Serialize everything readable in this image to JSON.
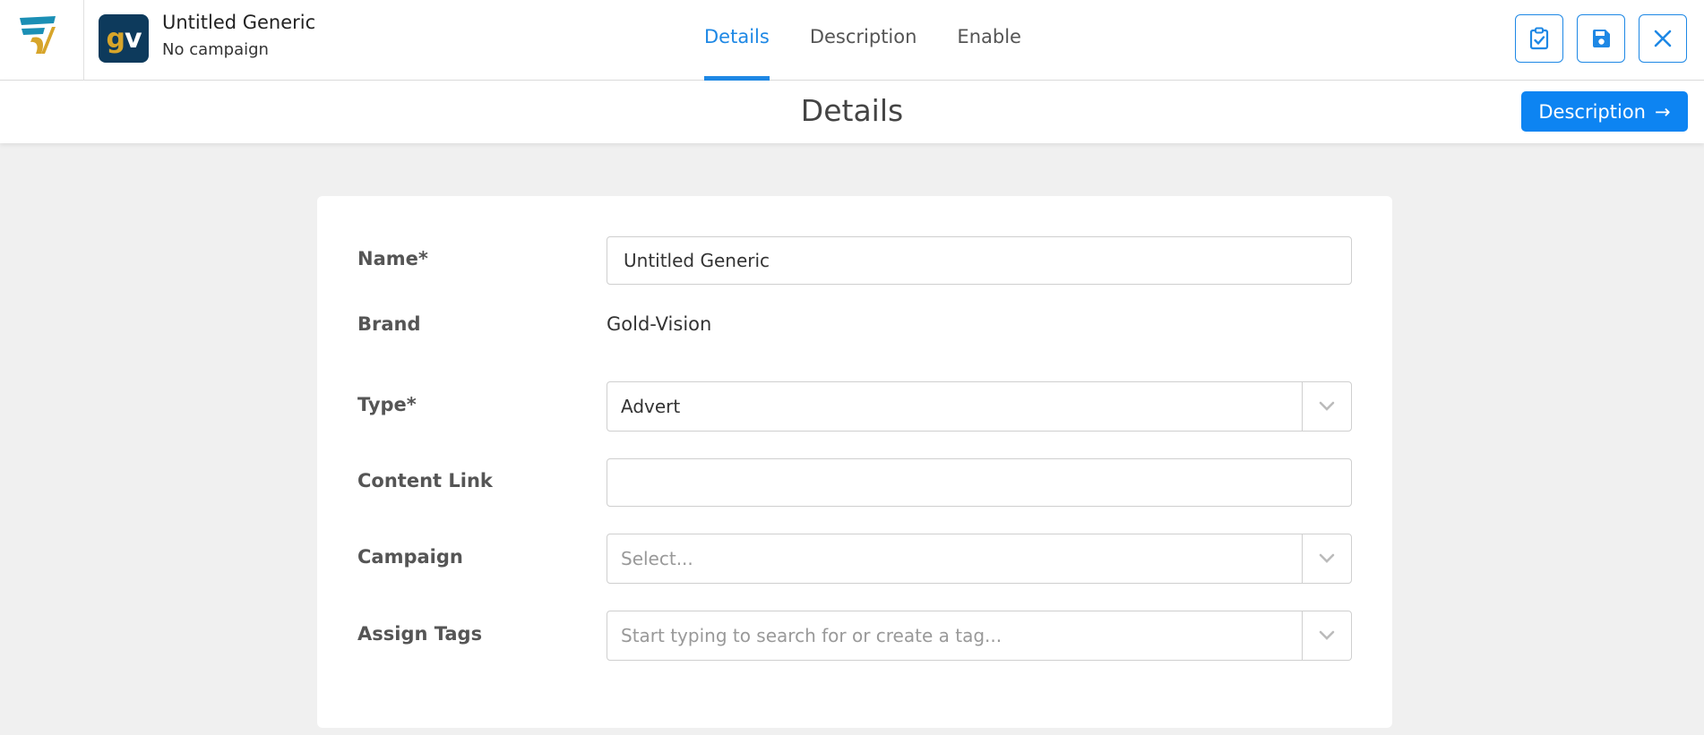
{
  "header": {
    "record_title": "Untitled Generic",
    "record_subtitle": "No campaign",
    "avatar_letters": {
      "first": "g",
      "second": "v"
    },
    "tabs": [
      {
        "label": "Details",
        "active": true
      },
      {
        "label": "Description",
        "active": false
      },
      {
        "label": "Enable",
        "active": false
      }
    ],
    "actions": [
      {
        "icon": "clipboard-check-icon"
      },
      {
        "icon": "save-icon"
      },
      {
        "icon": "close-icon"
      }
    ]
  },
  "subbar": {
    "page_title": "Details",
    "next_button_label": "Description",
    "next_button_arrow": "→"
  },
  "form": {
    "name": {
      "label": "Name*",
      "value": "Untitled Generic"
    },
    "brand": {
      "label": "Brand",
      "value": "Gold-Vision"
    },
    "type": {
      "label": "Type*",
      "value": "Advert"
    },
    "content_link": {
      "label": "Content Link",
      "value": ""
    },
    "campaign": {
      "label": "Campaign",
      "placeholder": "Select..."
    },
    "tags": {
      "label": "Assign Tags",
      "placeholder": "Start typing to search for or create a tag..."
    }
  },
  "colors": {
    "accent": "#1e88e5",
    "button": "#0d84f2",
    "avatar_bg": "#0d3a5c",
    "logo_gold": "#d7a52a",
    "logo_teal": "#1b8fb5"
  }
}
